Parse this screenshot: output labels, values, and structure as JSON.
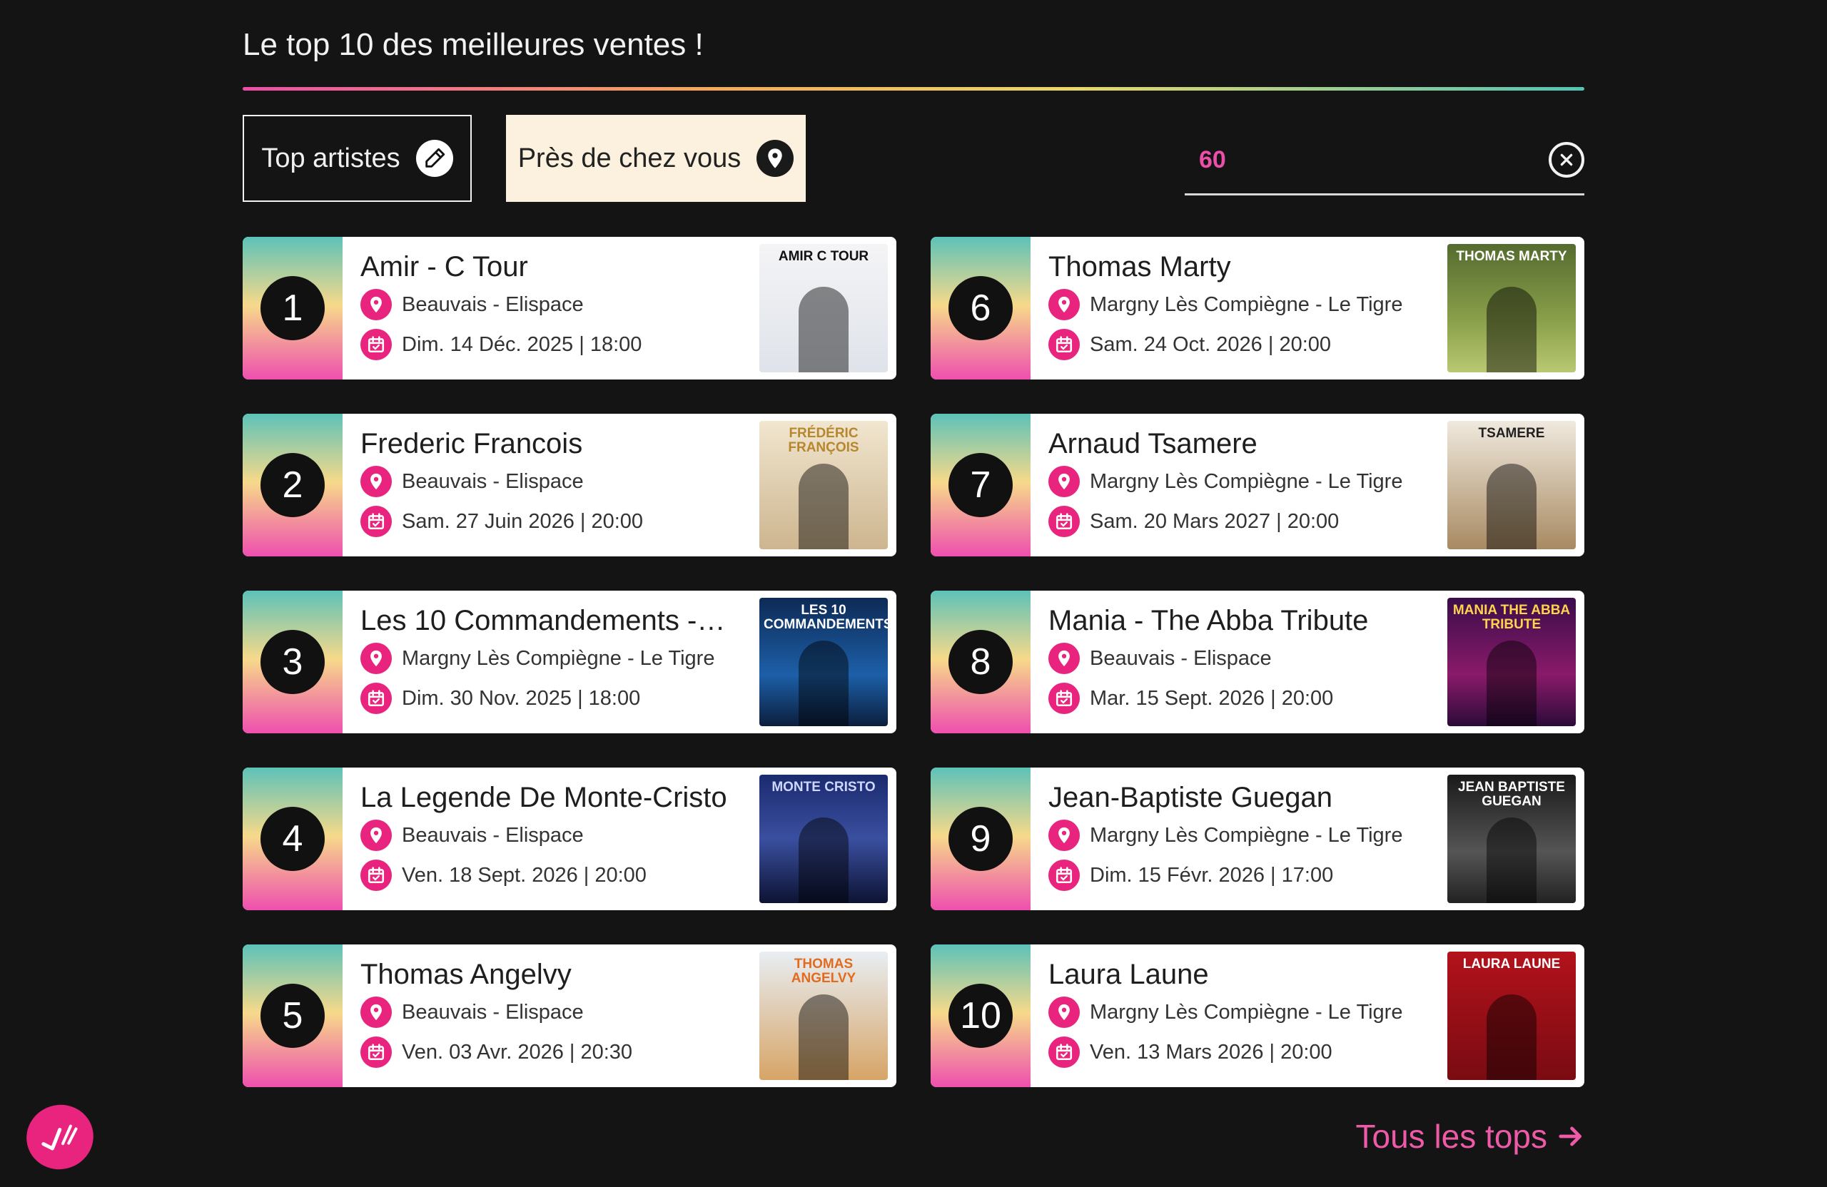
{
  "header": {
    "title": "Le top 10 des meilleures ventes !"
  },
  "filters": {
    "top_artists_label": "Top artistes",
    "near_you_label": "Près de chez vous",
    "location_value": "60"
  },
  "colors": {
    "accent_pink": "#e8247f",
    "near_you_bg": "#fcf1de"
  },
  "events": [
    {
      "rank": "1",
      "name": "Amir - C Tour",
      "venue": "Beauvais - Elispace",
      "date": "Dim. 14 Déc. 2025 | 18:00",
      "poster_text": "AMIR C TOUR"
    },
    {
      "rank": "2",
      "name": "Frederic Francois",
      "venue": "Beauvais - Elispace",
      "date": "Sam. 27 Juin 2026 | 20:00",
      "poster_text": "FRÉDÉRIC FRANÇOIS"
    },
    {
      "rank": "3",
      "name": "Les 10 Commandements -…",
      "venue": "Margny Lès Compiègne - Le Tigre",
      "date": "Dim. 30 Nov. 2025 | 18:00",
      "poster_text": "LES 10 COMMANDEMENTS"
    },
    {
      "rank": "4",
      "name": "La Legende De Monte-Cristo",
      "venue": "Beauvais - Elispace",
      "date": "Ven. 18 Sept. 2026 | 20:00",
      "poster_text": "MONTE CRISTO"
    },
    {
      "rank": "5",
      "name": "Thomas Angelvy",
      "venue": "Beauvais - Elispace",
      "date": "Ven. 03 Avr. 2026 | 20:30",
      "poster_text": "THOMAS ANGELVY"
    },
    {
      "rank": "6",
      "name": "Thomas Marty",
      "venue": "Margny Lès Compiègne - Le Tigre",
      "date": "Sam. 24 Oct. 2026 | 20:00",
      "poster_text": "THOMAS MARTY"
    },
    {
      "rank": "7",
      "name": "Arnaud Tsamere",
      "venue": "Margny Lès Compiègne - Le Tigre",
      "date": "Sam. 20 Mars 2027 | 20:00",
      "poster_text": "TSAMERE"
    },
    {
      "rank": "8",
      "name": "Mania - The Abba Tribute",
      "venue": "Beauvais - Elispace",
      "date": "Mar. 15 Sept. 2026 | 20:00",
      "poster_text": "MANIA THE ABBA TRIBUTE"
    },
    {
      "rank": "9",
      "name": "Jean-Baptiste Guegan",
      "venue": "Margny Lès Compiègne - Le Tigre",
      "date": "Dim. 15 Févr. 2026 | 17:00",
      "poster_text": "JEAN BAPTISTE GUEGAN"
    },
    {
      "rank": "10",
      "name": "Laura Laune",
      "venue": "Margny Lès Compiègne - Le Tigre",
      "date": "Ven. 13 Mars 2026 | 20:00",
      "poster_text": "LAURA LAUNE"
    }
  ],
  "footer": {
    "all_tops_label": "Tous les tops"
  }
}
